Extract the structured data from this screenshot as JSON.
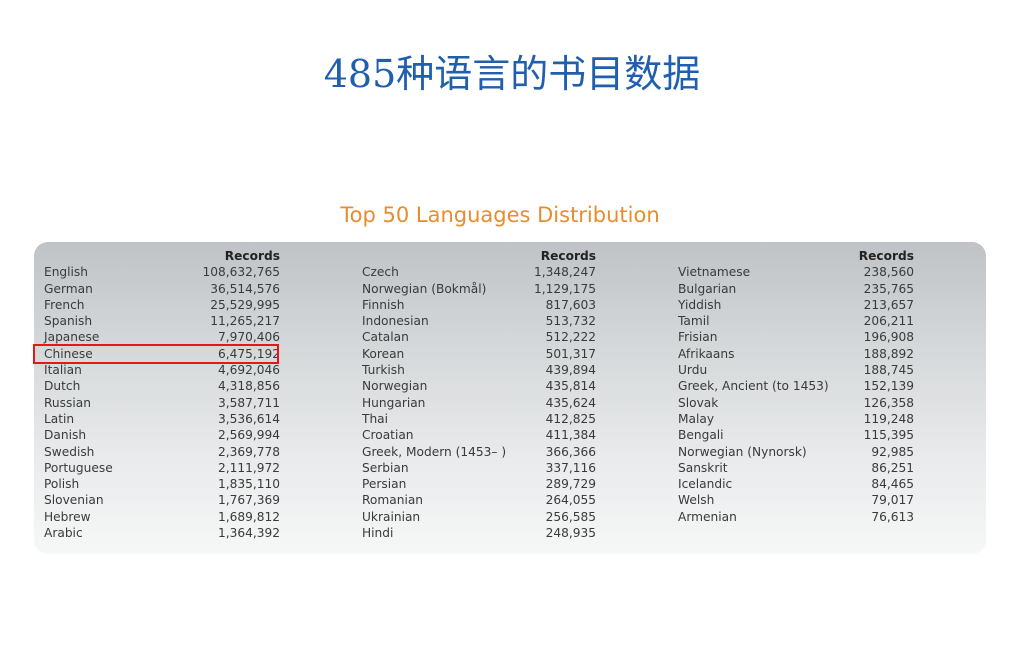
{
  "slide": {
    "title": "485种语言的书目数据"
  },
  "table": {
    "title": "Top 50 Languages Distribution",
    "records_header": "Records",
    "columns": [
      {
        "rows": [
          {
            "language": "English",
            "records": "108,632,765"
          },
          {
            "language": "German",
            "records": "36,514,576"
          },
          {
            "language": "French",
            "records": "25,529,995"
          },
          {
            "language": "Spanish",
            "records": "11,265,217"
          },
          {
            "language": "Japanese",
            "records": "7,970,406"
          },
          {
            "language": "Chinese",
            "records": "6,475,192"
          },
          {
            "language": "Italian",
            "records": "4,692,046"
          },
          {
            "language": "Dutch",
            "records": "4,318,856"
          },
          {
            "language": "Russian",
            "records": "3,587,711"
          },
          {
            "language": "Latin",
            "records": "3,536,614"
          },
          {
            "language": "Danish",
            "records": "2,569,994"
          },
          {
            "language": "Swedish",
            "records": "2,369,778"
          },
          {
            "language": "Portuguese",
            "records": "2,111,972"
          },
          {
            "language": "Polish",
            "records": "1,835,110"
          },
          {
            "language": "Slovenian",
            "records": "1,767,369"
          },
          {
            "language": "Hebrew",
            "records": "1,689,812"
          },
          {
            "language": "Arabic",
            "records": "1,364,392"
          }
        ]
      },
      {
        "rows": [
          {
            "language": "Czech",
            "records": "1,348,247"
          },
          {
            "language": "Norwegian (Bokmål)",
            "records": "1,129,175"
          },
          {
            "language": "Finnish",
            "records": "817,603"
          },
          {
            "language": "Indonesian",
            "records": "513,732"
          },
          {
            "language": "Catalan",
            "records": "512,222"
          },
          {
            "language": "Korean",
            "records": "501,317"
          },
          {
            "language": "Turkish",
            "records": "439,894"
          },
          {
            "language": "Norwegian",
            "records": "435,814"
          },
          {
            "language": "Hungarian",
            "records": "435,624"
          },
          {
            "language": "Thai",
            "records": "412,825"
          },
          {
            "language": "Croatian",
            "records": "411,384"
          },
          {
            "language": "Greek, Modern (1453– )",
            "records": "366,366"
          },
          {
            "language": "Serbian",
            "records": "337,116"
          },
          {
            "language": "Persian",
            "records": "289,729"
          },
          {
            "language": "Romanian",
            "records": "264,055"
          },
          {
            "language": "Ukrainian",
            "records": "256,585"
          },
          {
            "language": "Hindi",
            "records": "248,935"
          }
        ]
      },
      {
        "rows": [
          {
            "language": "Vietnamese",
            "records": "238,560"
          },
          {
            "language": "Bulgarian",
            "records": "235,765"
          },
          {
            "language": "Yiddish",
            "records": "213,657"
          },
          {
            "language": "Tamil",
            "records": "206,211"
          },
          {
            "language": "Frisian",
            "records": "196,908"
          },
          {
            "language": "Afrikaans",
            "records": "188,892"
          },
          {
            "language": "Urdu",
            "records": "188,745"
          },
          {
            "language": "Greek, Ancient (to 1453)",
            "records": "152,139"
          },
          {
            "language": "Slovak",
            "records": "126,358"
          },
          {
            "language": "Malay",
            "records": "119,248"
          },
          {
            "language": "Bengali",
            "records": "115,395"
          },
          {
            "language": "Norwegian (Nynorsk)",
            "records": "92,985"
          },
          {
            "language": "Sanskrit",
            "records": "86,251"
          },
          {
            "language": "Icelandic",
            "records": "84,465"
          },
          {
            "language": "Welsh",
            "records": "79,017"
          },
          {
            "language": "Armenian",
            "records": "76,613"
          }
        ]
      }
    ]
  },
  "highlight": {
    "language": "Chinese",
    "color": "#e8161b"
  },
  "colors": {
    "title": "#1f5fae",
    "table_title": "#e98c2c"
  }
}
